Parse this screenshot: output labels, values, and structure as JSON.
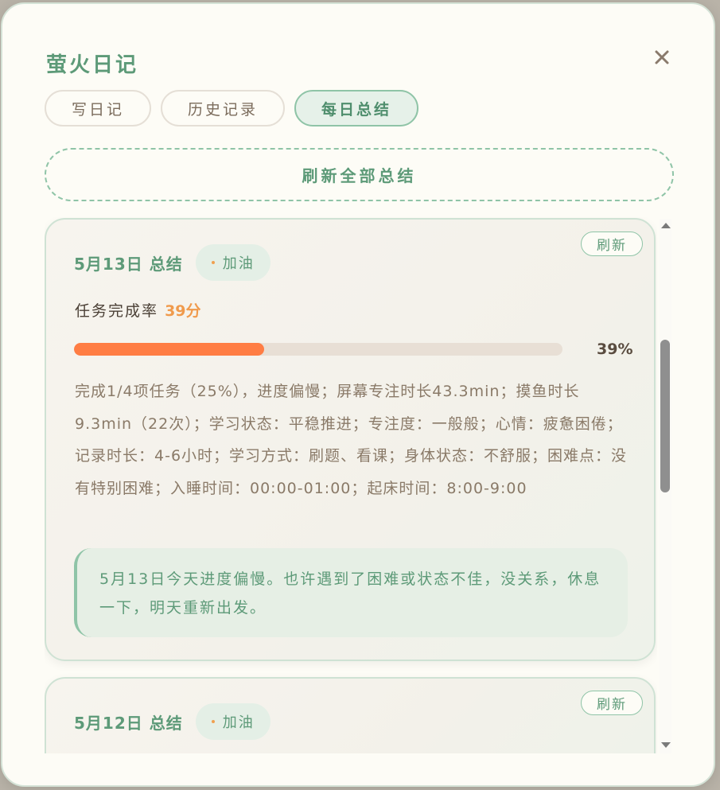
{
  "modal": {
    "title": "萤火日记",
    "close_icon": "close-icon"
  },
  "tabs": [
    {
      "label": "写日记",
      "active": false
    },
    {
      "label": "历史记录",
      "active": false
    },
    {
      "label": "每日总结",
      "active": true
    }
  ],
  "refresh_all_label": "刷新全部总结",
  "summaries": [
    {
      "date_title": "5月13日 总结",
      "badge": "加油",
      "refresh_label": "刷新",
      "rate_label": "任务完成率",
      "rate_score": "39分",
      "progress": 0.39,
      "progress_text": "39%",
      "detail": "完成1/4项任务（25%），进度偏慢；屏幕专注时长43.3min；摸鱼时长9.3min（22次）；学习状态：平稳推进；专注度：一般般；心情：疲惫困倦；记录时长：4-6小时；学习方式：刷题、看课；身体状态：不舒服；困难点：没有特别困难；入睡时间：00:00-01:00；起床时间：8:00-9:00",
      "quote": "5月13日今天进度偏慢。也许遇到了困难或状态不佳，没关系，休息一下，明天重新出发。"
    },
    {
      "date_title": "5月12日 总结",
      "badge": "加油",
      "refresh_label": "刷新"
    }
  ],
  "colors": {
    "accent_green": "#5d9a78",
    "progress_orange": "#ff7d44",
    "score_orange": "#f09a4c"
  }
}
